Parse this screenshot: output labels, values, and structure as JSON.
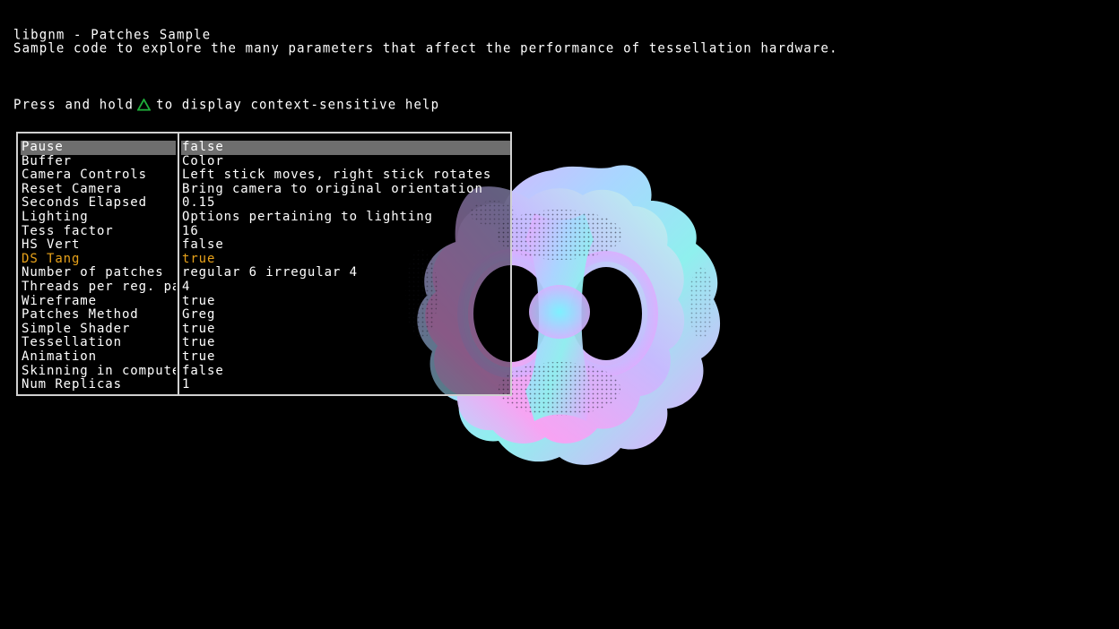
{
  "header": {
    "title": "libgnm - Patches Sample",
    "description": "Sample code to explore the many parameters that affect the performance of tessellation hardware.",
    "help_prefix": "Press and hold",
    "help_button_icon": "triangle-button-icon",
    "help_suffix": "to display context-sensitive help"
  },
  "colors": {
    "triangle_button": "#1fae3a",
    "highlight_text": "#e8a21a",
    "selected_row": "#6e6e6e",
    "panel_border": "#d0d0d0"
  },
  "menu": {
    "items": [
      {
        "label": "Pause",
        "value": "false"
      },
      {
        "label": "Buffer",
        "value": "Color"
      },
      {
        "label": "Camera Controls",
        "value": "Left stick moves, right stick rotates"
      },
      {
        "label": "Reset Camera",
        "value": "Bring camera to original orientation"
      },
      {
        "label": "Seconds Elapsed",
        "value": "0.15"
      },
      {
        "label": "Lighting",
        "value": "Options pertaining to lighting"
      },
      {
        "label": "Tess factor",
        "value": "16"
      },
      {
        "label": "HS Vert",
        "value": "false"
      },
      {
        "label": "DS Tang",
        "value": "true"
      },
      {
        "label": "Number of patches",
        "value": "regular 6 irregular 4"
      },
      {
        "label": "Threads per reg. patch",
        "value": "4"
      },
      {
        "label": "Wireframe",
        "value": "true"
      },
      {
        "label": "Patches Method",
        "value": "Greg"
      },
      {
        "label": "Simple Shader",
        "value": "true"
      },
      {
        "label": "Tessellation",
        "value": "true"
      },
      {
        "label": "Animation",
        "value": "true"
      },
      {
        "label": "Skinning in compute",
        "value": "false"
      },
      {
        "label": "Num Replicas",
        "value": "1"
      }
    ],
    "selected_item": "Pause",
    "highlighted_item": "DS Tang"
  }
}
